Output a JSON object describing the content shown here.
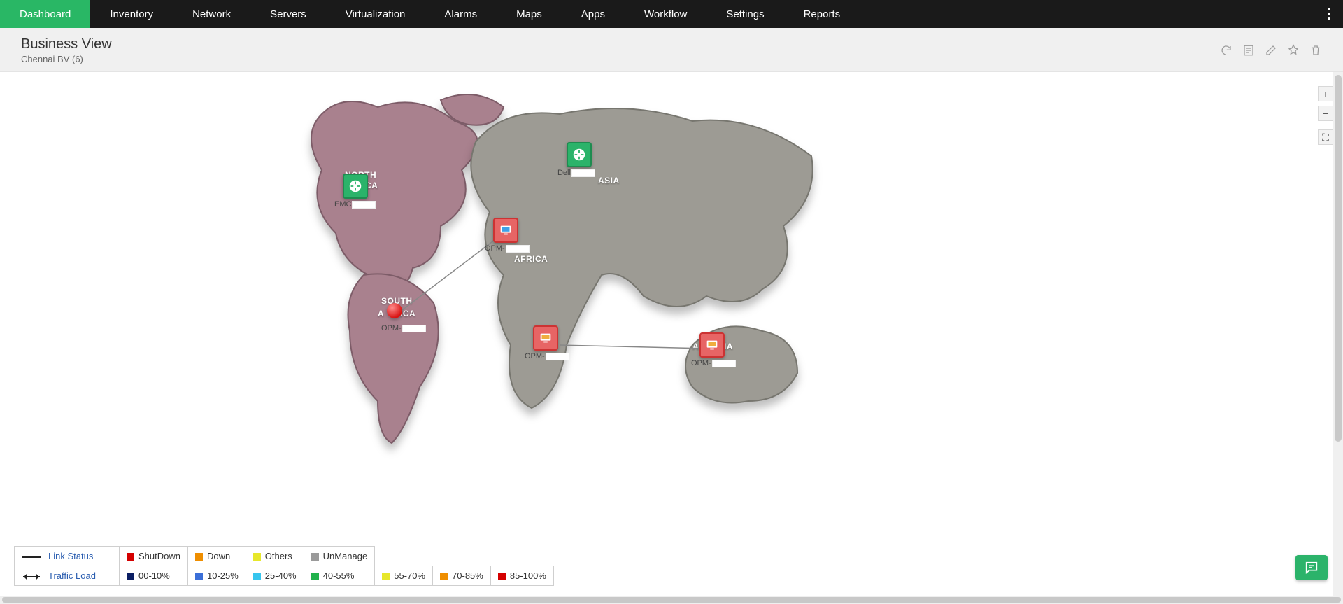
{
  "nav": {
    "tabs": [
      "Dashboard",
      "Inventory",
      "Network",
      "Servers",
      "Virtualization",
      "Alarms",
      "Maps",
      "Apps",
      "Workflow",
      "Settings",
      "Reports"
    ],
    "active_index": 0,
    "alert_index": 8
  },
  "header": {
    "title": "Business View",
    "subtitle": "Chennai BV (6)",
    "actions": [
      "refresh",
      "export",
      "edit",
      "pin",
      "delete"
    ]
  },
  "zoom": {
    "in": "+",
    "out": "−",
    "fs": "⛶"
  },
  "map": {
    "continent_labels": {
      "north_america_1": "NORTH",
      "north_america_2": "CA",
      "south_america_1": "SOUTH",
      "south_america_2": "A",
      "south_america_3": "ICA",
      "africa": "AFRICA",
      "asia": "ASIA",
      "australia_1": "A",
      "australia_2": "IA"
    },
    "nodes": {
      "na": {
        "label_prefix": "EMC",
        "type": "green-router"
      },
      "asia": {
        "label_prefix": "Dell",
        "type": "green-router"
      },
      "afr": {
        "label_prefix": "OPM-",
        "type": "red-host"
      },
      "sa": {
        "label_prefix": "OPM-",
        "type": "red-dot"
      },
      "saf": {
        "label_prefix": "OPM-",
        "type": "red-host"
      },
      "aus": {
        "label_prefix": "OPM-",
        "type": "red-host"
      }
    }
  },
  "legend": {
    "link_status": {
      "label": "Link Status",
      "items": [
        {
          "color": "#d40000",
          "text": "ShutDown"
        },
        {
          "color": "#ef8e00",
          "text": "Down"
        },
        {
          "color": "#e7e72b",
          "text": "Others"
        },
        {
          "color": "#9a9a9a",
          "text": "UnManage"
        }
      ]
    },
    "traffic_load": {
      "label": "Traffic Load",
      "items": [
        {
          "color": "#0b1e63",
          "text": "00-10%"
        },
        {
          "color": "#3b6fd8",
          "text": "10-25%"
        },
        {
          "color": "#37c5ee",
          "text": "25-40%"
        },
        {
          "color": "#22b24c",
          "text": "40-55%"
        },
        {
          "color": "#e7e72b",
          "text": "55-70%"
        },
        {
          "color": "#ef8e00",
          "text": "70-85%"
        },
        {
          "color": "#d40000",
          "text": "85-100%"
        }
      ]
    }
  }
}
